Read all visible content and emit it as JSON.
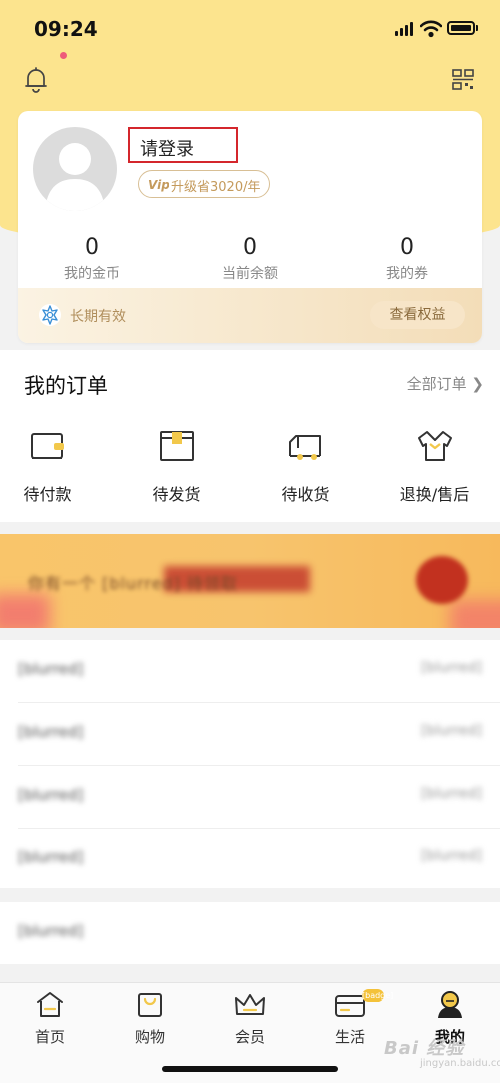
{
  "status_bar": {
    "time": "09:24"
  },
  "profile": {
    "login_prompt": "请登录",
    "vip_badge_text": "Vip",
    "vip_upgrade": "升级省3020/年",
    "stats": [
      {
        "value": "0",
        "label": "我的金币"
      },
      {
        "value": "0",
        "label": "当前余额"
      },
      {
        "value": "0",
        "label": "我的券"
      }
    ],
    "validity": "长期有效",
    "view_rights": "查看权益"
  },
  "orders": {
    "title": "我的订单",
    "all_orders": "全部订单 ❯",
    "items": [
      {
        "label": "待付款",
        "icon": "wallet-icon"
      },
      {
        "label": "待发货",
        "icon": "package-icon"
      },
      {
        "label": "待收货",
        "icon": "truck-icon"
      },
      {
        "label": "退换/售后",
        "icon": "shirt-return-icon"
      }
    ]
  },
  "banner": {
    "text": "你有一个 [blurred] 待领取",
    "cta": "[blurred]"
  },
  "menu": {
    "rows": [
      {
        "label": "[blurred]",
        "value": "[blurred]"
      },
      {
        "label": "[blurred]",
        "value": "[blurred]"
      },
      {
        "label": "[blurred]",
        "value": "[blurred]"
      },
      {
        "label": "[blurred]",
        "value": "[blurred]"
      },
      {
        "label": "[blurred]",
        "value": ""
      }
    ]
  },
  "tabbar": {
    "items": [
      {
        "label": "首页",
        "icon": "home-icon",
        "active": false
      },
      {
        "label": "购物",
        "icon": "shopping-bag-icon",
        "active": false
      },
      {
        "label": "会员",
        "icon": "crown-icon",
        "active": false
      },
      {
        "label": "生活",
        "icon": "card-icon",
        "active": false,
        "badge": "[badge]"
      },
      {
        "label": "我的",
        "icon": "user-icon",
        "active": true
      }
    ]
  },
  "watermark": {
    "text": "Bai 经验",
    "sub": "jingyan.baidu.com"
  },
  "colors": {
    "header_yellow": "#fce48e",
    "highlight_box": "#d4262c",
    "gold_text": "#c49a5c",
    "badge_yellow": "#f4c23a"
  }
}
